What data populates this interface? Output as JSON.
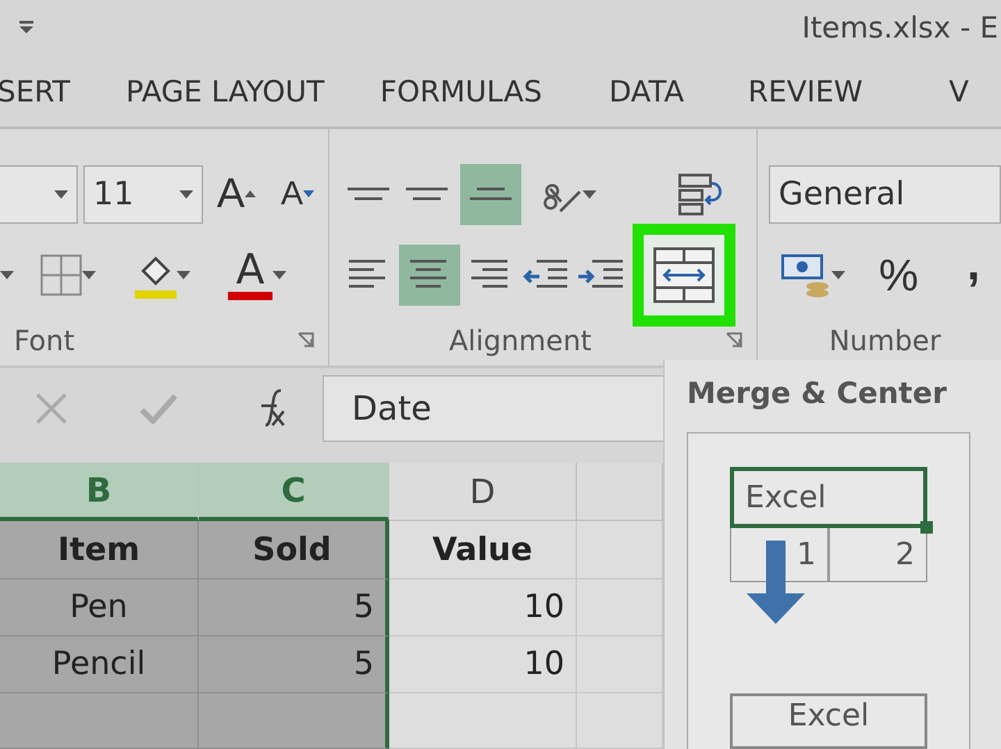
{
  "window": {
    "title": "Items.xlsx - E"
  },
  "tabs": [
    {
      "label": "SERT"
    },
    {
      "label": "PAGE LAYOUT"
    },
    {
      "label": "FORMULAS"
    },
    {
      "label": "DATA"
    },
    {
      "label": "REVIEW"
    },
    {
      "label": "V"
    }
  ],
  "ribbon": {
    "font": {
      "label": "Font",
      "size": "11",
      "grow_label": "A",
      "shrink_label": "A",
      "color_label": "A"
    },
    "alignment": {
      "label": "Alignment",
      "row_1": [
        {
          "kind": "top",
          "on": false
        },
        {
          "kind": "middle",
          "on": false
        },
        {
          "kind": "bottom",
          "on": true
        },
        {
          "kind": "orientation",
          "on": false
        },
        {
          "kind": "wrap",
          "on": false
        }
      ],
      "row_2": [
        {
          "kind": "left",
          "on": false
        },
        {
          "kind": "center",
          "on": true
        },
        {
          "kind": "right",
          "on": false
        },
        {
          "kind": "outdent",
          "on": false
        },
        {
          "kind": "indent",
          "on": false
        },
        {
          "kind": "merge",
          "on": true
        }
      ]
    },
    "number": {
      "label": "Number",
      "format": "General",
      "percent": "%",
      "comma": ","
    }
  },
  "formula_bar": {
    "value": "Date"
  },
  "sheet": {
    "columns": [
      {
        "label": "B",
        "selected": true
      },
      {
        "label": "C",
        "selected": true
      },
      {
        "label": "D",
        "selected": false
      }
    ],
    "rows": [
      {
        "kind": "header",
        "cells": [
          "Item",
          "Sold",
          "Value"
        ]
      },
      {
        "kind": "data",
        "cells": [
          "Pen",
          "5",
          "10"
        ]
      },
      {
        "kind": "data",
        "cells": [
          "Pencil",
          "5",
          "10"
        ]
      }
    ]
  },
  "tooltip": {
    "title": "Merge & Center",
    "before": {
      "merged": "Excel",
      "cells": [
        "1",
        "2"
      ]
    },
    "after": {
      "merged": "Excel"
    }
  }
}
